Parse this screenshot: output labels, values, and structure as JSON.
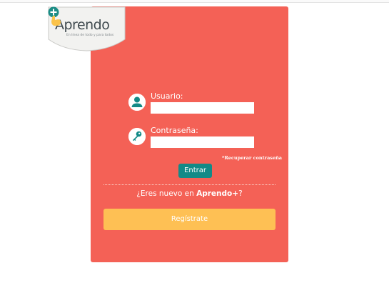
{
  "brand": {
    "name": "Aprendo",
    "tagline": "En línea de todo y para todos"
  },
  "login": {
    "username_label": "Usuario:",
    "username_value": "",
    "password_label": "Contraseña:",
    "password_value": "",
    "forgot_password": "*Recuperar contraseña",
    "submit_label": "Entrar"
  },
  "signup": {
    "prompt_prefix": "¿Eres nuevo en ",
    "prompt_brand": "Aprendo+",
    "prompt_suffix": "?",
    "register_label": "Regístrate"
  },
  "colors": {
    "card": "#f46156",
    "accent_teal": "#138a87",
    "register_yellow": "#fec054",
    "logo_plus_teal": "#1c8d86",
    "logo_plus_yellow": "#fbc34a"
  },
  "icons": {
    "username": "user-icon",
    "password": "key-icon",
    "logo": "plus-hand-icon"
  }
}
